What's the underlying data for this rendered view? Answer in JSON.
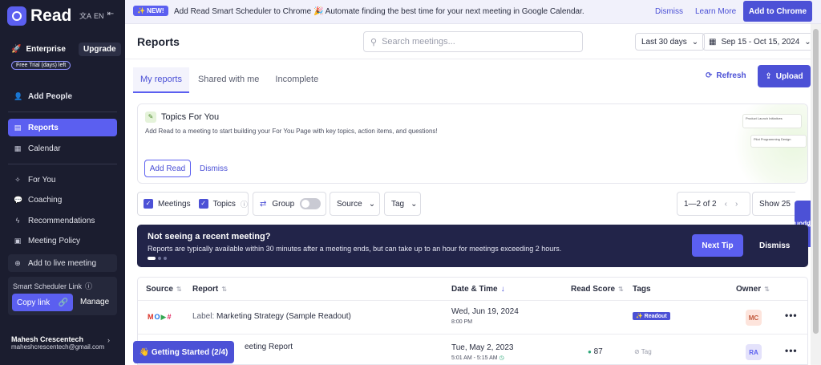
{
  "sidebar": {
    "brand": "Read",
    "language": "EN",
    "plan": "Enterprise",
    "upgrade_label": "Upgrade",
    "trial_label": "Free Trial (days) left",
    "add_people": "Add People",
    "nav": [
      {
        "label": "Reports",
        "icon": "document-icon"
      },
      {
        "label": "Calendar",
        "icon": "calendar-icon"
      },
      {
        "label": "For You",
        "icon": "sparkle-icon"
      },
      {
        "label": "Coaching",
        "icon": "chat-icon"
      },
      {
        "label": "Recommendations",
        "icon": "bolt-icon"
      },
      {
        "label": "Meeting Policy",
        "icon": "policy-icon"
      }
    ],
    "live_meeting": "Add to live meeting",
    "scheduler_label": "Smart Scheduler Link",
    "copy_link": "Copy link",
    "manage": "Manage",
    "user_name": "Mahesh Crescentech",
    "user_email": "maheshcrescentech@gmail.com"
  },
  "banner": {
    "badge": "✨ NEW!",
    "headline": "Add Read Smart Scheduler to Chrome",
    "text": "🎉 Automate finding the best time for your next meeting in Google Calendar.",
    "dismiss": "Dismiss",
    "learn_more": "Learn More",
    "cta": "Add to Chrome"
  },
  "header": {
    "title": "Reports",
    "search_placeholder": "Search meetings...",
    "range": "Last 30 days",
    "dates": "Sep 15 - Oct 15, 2024"
  },
  "tabs": [
    "My reports",
    "Shared with me",
    "Incomplete"
  ],
  "actions": {
    "refresh": "Refresh",
    "upload": "Upload"
  },
  "topics": {
    "title": "Topics For You",
    "description": "Add Read to a meeting to start building your For You Page with key topics, action items, and questions!",
    "add_read": "Add Read",
    "dismiss": "Dismiss",
    "art_cards": [
      "Product Launch Initiatives",
      "Pilot Programming Design"
    ]
  },
  "filters": {
    "meetings": "Meetings",
    "topics": "Topics",
    "group": "Group",
    "source": "Source",
    "tag": "Tag",
    "pager": "1—2 of 2",
    "show": "Show 25"
  },
  "support": "Support",
  "tip": {
    "title": "Not seeing a recent meeting?",
    "text": "Reports are typically available within 30 minutes after a meeting ends, but can take up to an hour for meetings exceeding 2 hours.",
    "next": "Next Tip",
    "dismiss": "Dismiss"
  },
  "table": {
    "columns": [
      "Source",
      "Report",
      "Date & Time",
      "Read Score",
      "Tags",
      "Owner"
    ],
    "rows": [
      {
        "label_prefix": "Label:",
        "report": "Marketing Strategy (Sample Readout)",
        "date": "Wed, Jun 19, 2024",
        "time": "8:00 PM",
        "score": "",
        "tag": "✨ Readout",
        "owner": "MC"
      },
      {
        "label_prefix": "",
        "report": "eeting Report",
        "date": "Tue, May 2, 2023",
        "time": "5:01 AM - 5:15 AM",
        "score": "87",
        "tag": "Tag",
        "owner": "RA"
      }
    ]
  },
  "getting_started": "👋 Getting Started (2/4)",
  "colors": {
    "accent": "#5b5ff0",
    "sidebar": "#1b1d2f",
    "tip_bg": "#222449"
  }
}
